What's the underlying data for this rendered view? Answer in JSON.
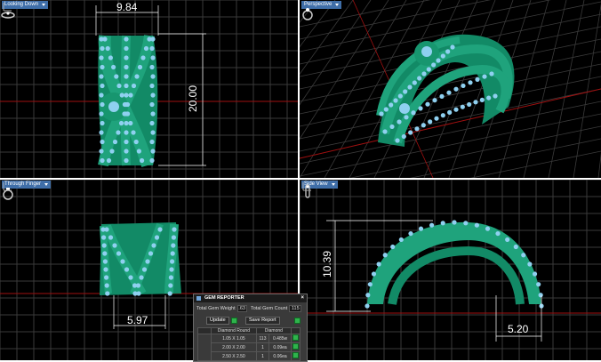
{
  "viewports": {
    "top_left": {
      "label": "Looking Down",
      "dims": [
        "9.84",
        "20.00"
      ]
    },
    "top_right": {
      "label": "Perspective"
    },
    "bottom_left": {
      "label": "Through Finger",
      "dims": [
        "5.97"
      ]
    },
    "bottom_right": {
      "label": "Side View",
      "dims": [
        "10.39",
        "5.20"
      ]
    }
  },
  "icons": {
    "ring": "ring-view-icon",
    "axes": "axis-triad-icon"
  },
  "gem_reporter": {
    "title": "GEM REPORTER",
    "total_weight_label": "Total Gem Weight",
    "total_weight_value": ".63",
    "total_count_label": "Total Gem Count",
    "total_count_value": "115",
    "update_label": "Update",
    "save_report_label": "Save Report",
    "table_headers": [
      "Diamond Round",
      "Diamond"
    ],
    "rows": [
      {
        "size": "1.05 X 1.05",
        "count": "113",
        "weight": "0.485w"
      },
      {
        "size": "2.00 X 2.00",
        "count": "1",
        "weight": "0.09ea"
      },
      {
        "size": "2.50 X 2.50",
        "count": "1",
        "weight": "0.06ea"
      }
    ]
  },
  "colors": {
    "background": "#000000",
    "grid": "#3a3a3a",
    "grid_red": "#a01010",
    "metal": "#1fa37c",
    "gem": "#8fd0f0",
    "viewport_tag": "#3f6ea8"
  }
}
